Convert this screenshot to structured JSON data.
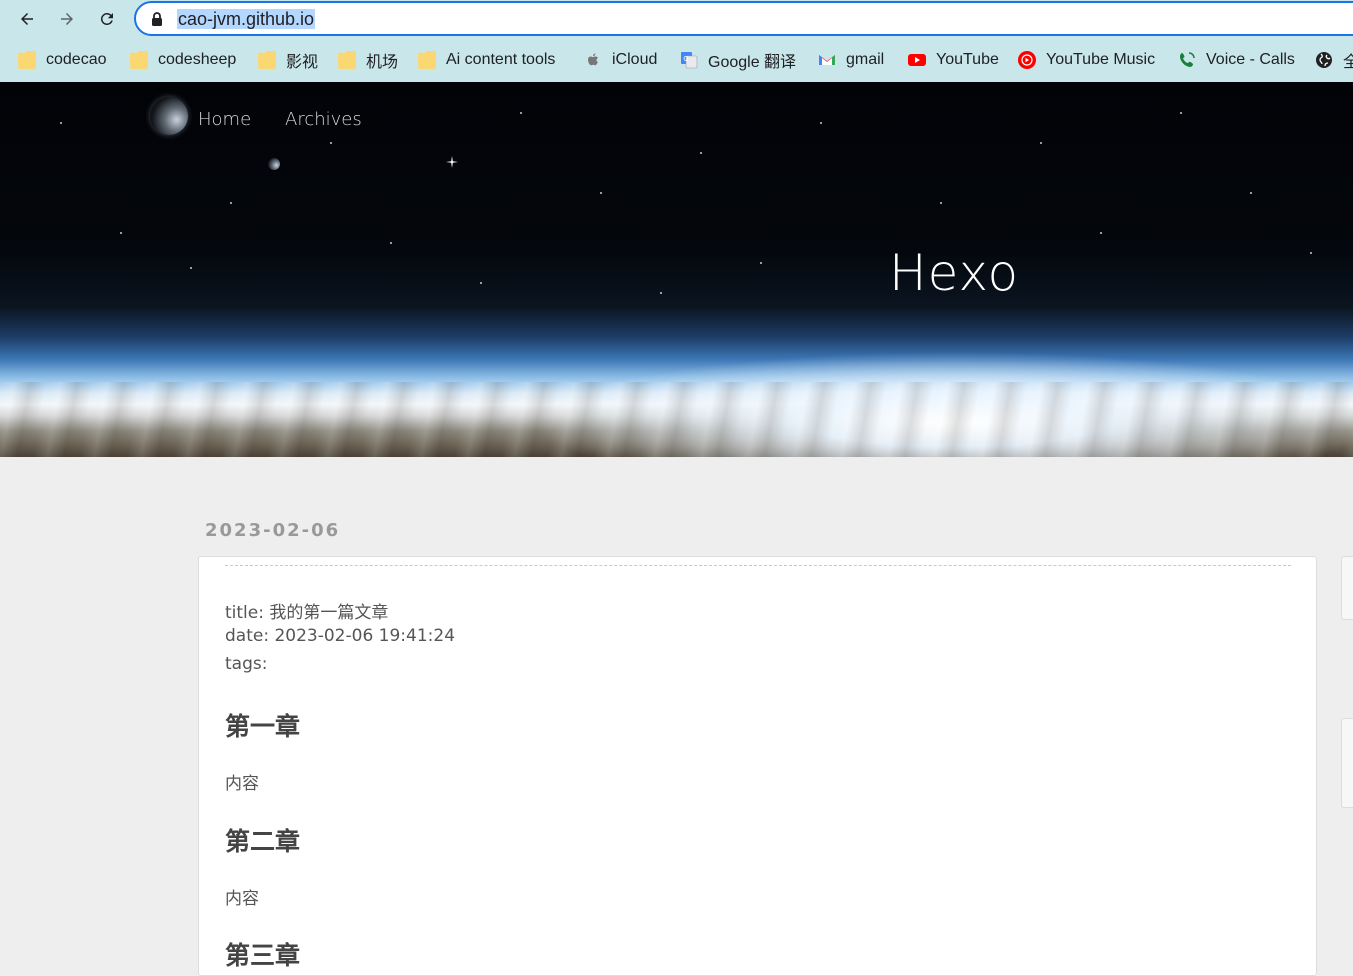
{
  "browser": {
    "url": "cao-jvm.github.io",
    "bookmarks": [
      {
        "label": "codecao",
        "icon": "folder-icon"
      },
      {
        "label": "codesheep",
        "icon": "folder-icon"
      },
      {
        "label": "影视",
        "icon": "folder-icon"
      },
      {
        "label": "机场",
        "icon": "folder-icon"
      },
      {
        "label": "Ai content tools",
        "icon": "folder-icon"
      },
      {
        "label": "iCloud",
        "icon": "apple-icon"
      },
      {
        "label": "Google 翻译",
        "icon": "google-translate-icon"
      },
      {
        "label": "gmail",
        "icon": "gmail-icon"
      },
      {
        "label": "YouTube",
        "icon": "youtube-icon"
      },
      {
        "label": "YouTube Music",
        "icon": "youtube-music-icon"
      },
      {
        "label": "Voice - Calls",
        "icon": "voice-icon"
      },
      {
        "label": "全",
        "icon": "globe-icon"
      }
    ]
  },
  "site": {
    "title": "Hexo",
    "nav": [
      "Home",
      "Archives"
    ]
  },
  "post": {
    "date": "2023-02-06",
    "meta_title": "title: 我的第一篇文章",
    "meta_date": "date: 2023-02-06 19:41:24",
    "meta_tags": "tags:",
    "sections": [
      {
        "heading": "第一章",
        "body": "内容"
      },
      {
        "heading": "第二章",
        "body": "内容"
      },
      {
        "heading": "第三章",
        "body": ""
      }
    ]
  },
  "colors": {
    "accent": "#1a73e8",
    "chrome_bg": "#c9e7ea",
    "page_bg": "#eeeeee",
    "date_text": "#999999"
  }
}
